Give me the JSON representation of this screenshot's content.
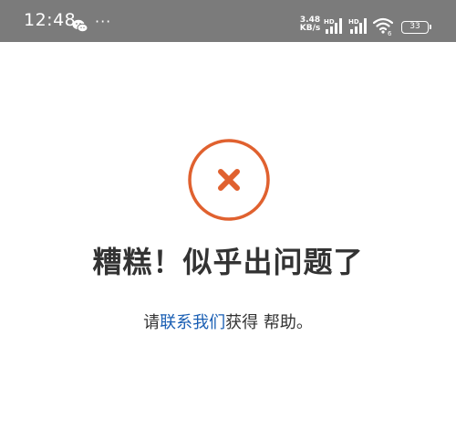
{
  "status_bar": {
    "time": "12:48",
    "more": "···",
    "net_speed_value": "3.48",
    "net_speed_unit": "KB/s",
    "sim1_label": "HD",
    "sim2_label": "HD",
    "wifi_label": "6",
    "battery": "33"
  },
  "error": {
    "title": "糟糕！似乎出问题了",
    "help_prefix": "请",
    "help_link": "联系我们",
    "help_suffix": "获得 帮助。"
  },
  "colors": {
    "status_bar_bg": "#7b7b7b",
    "error_accent": "#e0612f",
    "link": "#1a5fb4",
    "text": "#333333"
  }
}
